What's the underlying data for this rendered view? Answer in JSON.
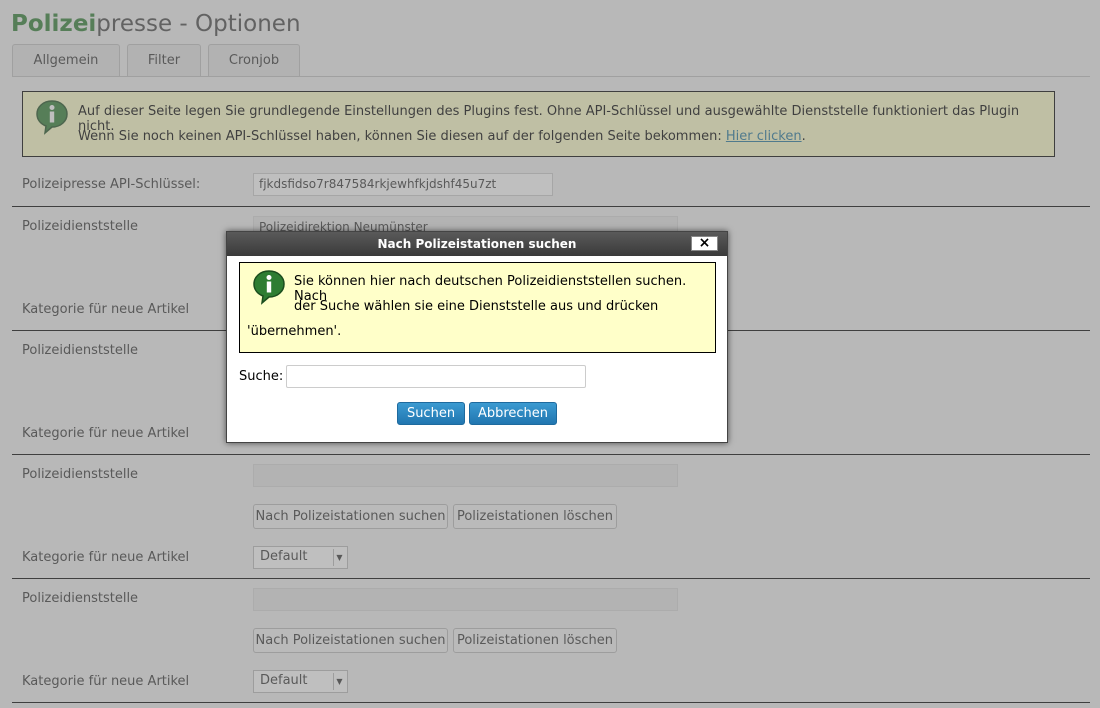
{
  "header": {
    "title_brand": "Polizei",
    "title_rest": "presse - Optionen"
  },
  "tabs": [
    {
      "label": "Allgemein"
    },
    {
      "label": "Filter"
    },
    {
      "label": "Cronjob"
    }
  ],
  "notice": {
    "line1": "Auf dieser Seite legen Sie grundlegende Einstellungen des Plugins fest. Ohne API-Schlüssel und ausgewählte Dienststelle funktioniert das Plugin nicht.",
    "line2_prefix": "Wenn Sie noch keinen API-Schlüssel haben, können Sie diesen auf der folgenden Seite bekommen: ",
    "line2_link": "Hier clicken",
    "line2_suffix": "."
  },
  "api": {
    "label": "Polizeipresse API-Schlüssel:",
    "value": "fjkdsfidso7r847584rkjewhfkjdshf45u7zt"
  },
  "sections": [
    {
      "office_label": "Polizeidienststelle",
      "office_value": "Polizeidirektion Neumünster",
      "category_label": "Kategorie für neue Artikel"
    },
    {
      "office_label": "Polizeidienststelle",
      "category_label": "Kategorie für neue Artikel"
    },
    {
      "office_label": "Polizeidienststelle",
      "search_btn": "Nach Polizeistationen suchen",
      "delete_btn": "Polizeistationen löschen",
      "category_label": "Kategorie für neue Artikel",
      "category_value": "Default"
    },
    {
      "office_label": "Polizeidienststelle",
      "search_btn": "Nach Polizeistationen suchen",
      "delete_btn": "Polizeistationen löschen",
      "category_label": "Kategorie für neue Artikel",
      "category_value": "Default"
    }
  ],
  "modal": {
    "title": "Nach Polizeistationen suchen",
    "close": "×",
    "info_line1": "Sie können hier nach deutschen Polizeidienststellen suchen. Nach",
    "info_line2": "der Suche wählen sie eine Dienststelle aus und drücken",
    "info_line3": "'übernehmen'.",
    "search_label": "Suche:",
    "search_value": "",
    "search_button": "Suchen",
    "cancel_button": "Abbrechen"
  },
  "icons": {
    "info": "info-speech-bubble-icon",
    "select_arrow": "dropdown-arrow-icon"
  },
  "colors": {
    "brand": "#2e7d32",
    "notice_bg": "#ffffc9",
    "button_blue": "#2176b0",
    "link": "#21759b"
  }
}
